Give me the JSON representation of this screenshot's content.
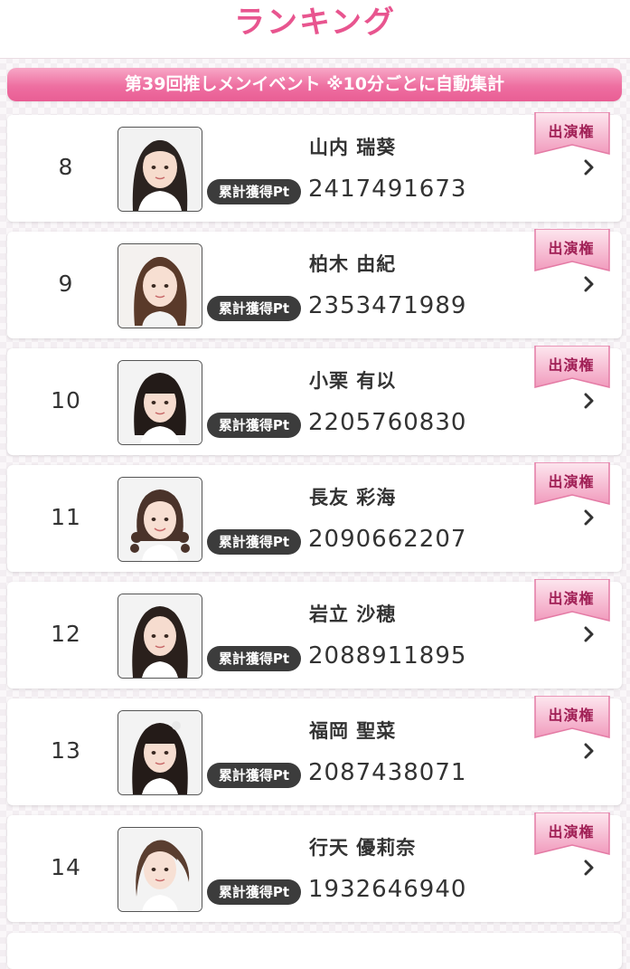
{
  "header": {
    "title": "ランキング"
  },
  "event": {
    "banner": "第39回推しメンイベント ※10分ごとに自動集計"
  },
  "ranking": {
    "pt_badge_label": "累計獲得Pt",
    "ribbon_label": "出演権",
    "entries": [
      {
        "rank": "8",
        "name": "山内 瑞葵",
        "points": "2417491673"
      },
      {
        "rank": "9",
        "name": "柏木 由紀",
        "points": "2353471989"
      },
      {
        "rank": "10",
        "name": "小栗 有以",
        "points": "2205760830"
      },
      {
        "rank": "11",
        "name": "長友 彩海",
        "points": "2090662207"
      },
      {
        "rank": "12",
        "name": "岩立 沙穂",
        "points": "2088911895"
      },
      {
        "rank": "13",
        "name": "福岡 聖菜",
        "points": "2087438071"
      },
      {
        "rank": "14",
        "name": "行天 優莉奈",
        "points": "1932646940"
      }
    ]
  },
  "icons": {
    "chevron": "chevron-right-icon",
    "ribbon": "ribbon-badge-icon",
    "avatar": "member-photo"
  },
  "colors": {
    "title_pink": "#e8558f",
    "banner_pink": "#ee6fa1",
    "badge_dark": "#3c3c3c",
    "ribbon_text": "#a01f55"
  }
}
